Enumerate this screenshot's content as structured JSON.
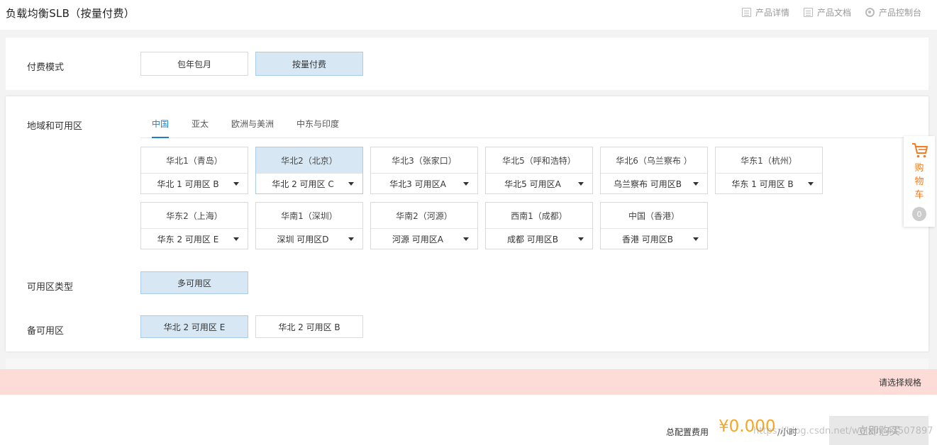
{
  "header": {
    "title": "负载均衡SLB（按量付费）",
    "links": [
      {
        "label": "产品详情",
        "icon": "doc-icon"
      },
      {
        "label": "产品文档",
        "icon": "doc-icon"
      },
      {
        "label": "产品控制台",
        "icon": "gear-icon"
      }
    ]
  },
  "billing": {
    "label": "付费模式",
    "options": [
      "包年包月",
      "按量付费"
    ],
    "selected": "按量付费"
  },
  "region": {
    "label": "地域和可用区",
    "tabs": [
      "中国",
      "亚太",
      "欧洲与美洲",
      "中东与印度"
    ],
    "active_tab": "中国",
    "zones": [
      {
        "name": "华北1（青岛）",
        "zone": "华北 1 可用区 B"
      },
      {
        "name": "华北2（北京）",
        "zone": "华北 2 可用区 C",
        "selected": true
      },
      {
        "name": "华北3（张家口）",
        "zone": "华北3 可用区A"
      },
      {
        "name": "华北5（呼和浩特）",
        "zone": "华北5 可用区A"
      },
      {
        "name": "华北6（乌兰察布 ）",
        "zone": "乌兰察布 可用区B"
      },
      {
        "name": "华东1（杭州）",
        "zone": "华东 1 可用区 B"
      },
      {
        "name": "华东2（上海）",
        "zone": "华东 2 可用区 E"
      },
      {
        "name": "华南1（深圳）",
        "zone": "深圳 可用区D"
      },
      {
        "name": "华南2（河源）",
        "zone": "河源 可用区A"
      },
      {
        "name": "西南1（成都）",
        "zone": "成都 可用区B"
      },
      {
        "name": "中国（香港）",
        "zone": "香港 可用区B"
      }
    ]
  },
  "zone_type": {
    "label": "可用区类型",
    "option": "多可用区"
  },
  "backup_zone": {
    "label": "备可用区",
    "options": [
      "华北 2 可用区 E",
      "华北 2 可用区 B"
    ],
    "selected": "华北 2 可用区 E"
  },
  "cart": {
    "label_chars": [
      "购",
      "物",
      "车"
    ],
    "count": "0"
  },
  "notice": {
    "text": "请选择规格"
  },
  "footer": {
    "total_label": "总配置费用",
    "price": "¥0.000",
    "unit": "/小时",
    "buy_label": "立即购买",
    "watermark": "https://blog.csdn.net/weixin_43507897"
  },
  "colors": {
    "accent": "#1e7ec8",
    "selected_bg": "#d7e8f4",
    "price": "#f5a623",
    "cart": "#f47b20",
    "notice_bg": "#fddcd8"
  }
}
